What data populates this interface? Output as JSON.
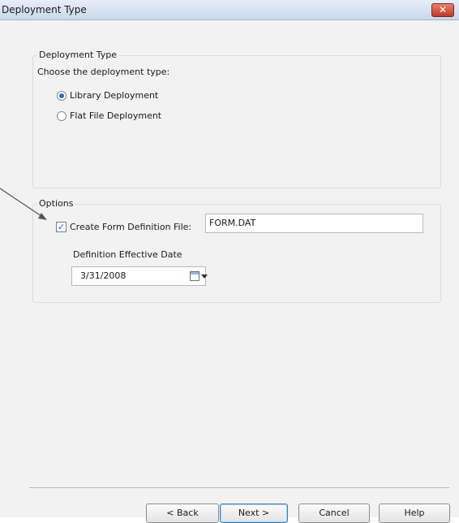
{
  "window": {
    "title": "Deployment Type",
    "close_label": "✕"
  },
  "deployment_group": {
    "legend": "Deployment Type",
    "prompt": "Choose the deployment type:",
    "options": [
      {
        "label": "Library Deployment",
        "selected": true
      },
      {
        "label": "Flat File Deployment",
        "selected": false
      }
    ]
  },
  "options_group": {
    "legend": "Options",
    "create_form_def": {
      "label": "Create Form Definition File:",
      "checked": true,
      "check_glyph": "✓",
      "value": "FORM.DAT"
    },
    "effective_date": {
      "label": "Definition Effective Date",
      "value": "3/31/2008",
      "icon": "calendar-icon"
    }
  },
  "buttons": {
    "back": "< Back",
    "next": "Next >",
    "cancel": "Cancel",
    "help": "Help"
  }
}
